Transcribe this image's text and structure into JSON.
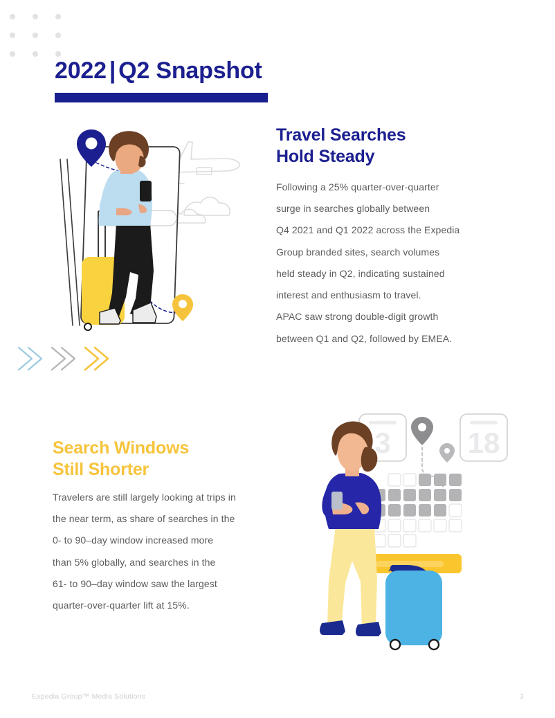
{
  "document": {
    "page_number": "3",
    "footer_brand": "Expedia Group™ Media Solutions"
  },
  "header": {
    "year": "2022",
    "separator": "|",
    "title": "Q2 Snapshot",
    "full_title": "2022  |  Q2 Snapshot",
    "rule_color": "#1a1f8f"
  },
  "sections": [
    {
      "id": "travel-searches",
      "heading_line1": "Travel Searches",
      "heading_line2": "Hold Steady",
      "heading_color": "#1b1f8f",
      "body_lines": [
        "Following a 25% quarter-over-quarter",
        "surge in searches globally between",
        "Q4 2021 and Q1 2022 across the Expedia",
        "Group branded sites, search volumes",
        "held steady in Q2, indicating sustained",
        "interest and enthusiasm to travel.",
        "APAC saw strong double-digit growth",
        "between Q1 and Q2, followed by EMEA."
      ]
    },
    {
      "id": "search-windows",
      "heading_line1": "Search Windows",
      "heading_line2": "Still Shorter",
      "heading_color": "#f6c43c",
      "body_lines": [
        "Travelers are still largely looking at trips in",
        "the near term, as share of searches in the",
        "0- to 90–day window increased more",
        "than 5% globally, and searches in the",
        "61- to 90–day window saw the largest",
        "quarter-over-quarter lift at 15%."
      ]
    }
  ],
  "illustration_one": {
    "name": "woman-with-phone-and-suitcase",
    "elements": [
      "smartphone-outline",
      "search-bar",
      "blue-map-pin",
      "yellow-map-pin",
      "dashed-route",
      "airplane-outline",
      "cloud-outline",
      "yellow-suitcase",
      "traveler-figure"
    ]
  },
  "illustration_two": {
    "name": "woman-with-calendar-and-suitcase",
    "calendar_start_day": "3",
    "calendar_end_day": "18",
    "elements": [
      "calendar-card-start",
      "calendar-card-end",
      "gray-map-pin-start",
      "gray-map-pin-end",
      "dashed-route",
      "calendar-grid",
      "yellow-search-button",
      "blue-suitcase",
      "traveler-figure"
    ]
  },
  "chevrons": {
    "items": [
      {
        "name": "chevron-blue",
        "color": "#9ccbe0"
      },
      {
        "name": "chevron-gray",
        "color": "#b5b5b7"
      },
      {
        "name": "chevron-yellow",
        "color": "#f6c43c"
      }
    ]
  },
  "palette": {
    "navy": "#1b1f8f",
    "yellow": "#f6c43c",
    "light_blue": "#4cb3e4",
    "body_gray": "#5c5c5e",
    "dot_gray": "#e2e2e4",
    "footer_gray": "#cfcfd2"
  }
}
